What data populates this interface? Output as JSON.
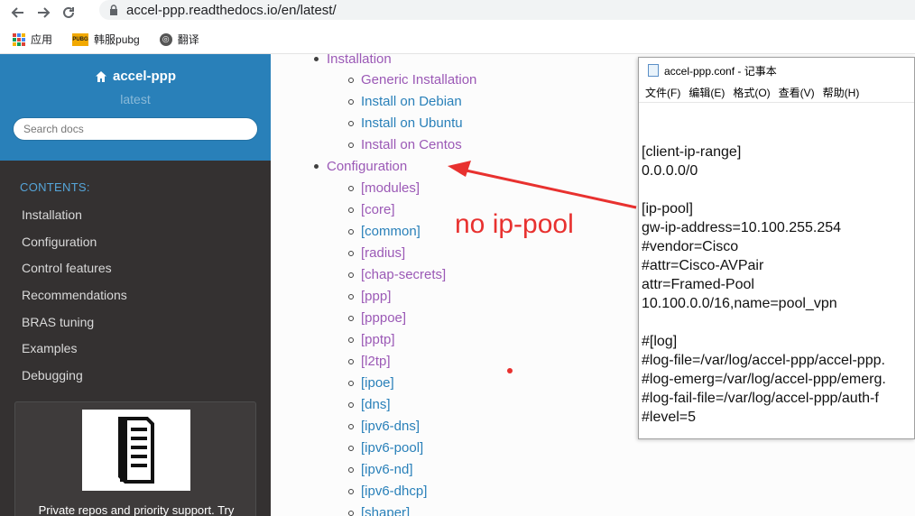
{
  "browser": {
    "url": "accel-ppp.readthedocs.io/en/latest/",
    "bookmarks": [
      "应用",
      "韩服pubg",
      "翻译"
    ],
    "pubg_icon_text": "PUBG"
  },
  "sidebar": {
    "project": "accel-ppp",
    "version": "latest",
    "search_placeholder": "Search docs",
    "caption": "CONTENTS:",
    "items": [
      "Installation",
      "Configuration",
      "Control features",
      "Recommendations",
      "BRAS tuning",
      "Examples",
      "Debugging"
    ],
    "promo_text": "Private repos and priority support. Try"
  },
  "toc": {
    "installation": "Installation",
    "installation_children": [
      "Generic Installation",
      "Install on Debian",
      "Install on Ubuntu",
      "Install on Centos"
    ],
    "configuration": "Configuration",
    "configuration_children": [
      "[modules]",
      "[core]",
      "[common]",
      "[radius]",
      "[chap-secrets]",
      "[ppp]",
      "[pppoe]",
      "[pptp]",
      "[l2tp]",
      "[ipoe]",
      "[dns]",
      "[ipv6-dns]",
      "[ipv6-pool]",
      "[ipv6-nd]",
      "[ipv6-dhcp]",
      "[shaper]"
    ]
  },
  "annotation": "no ip-pool",
  "notepad": {
    "title": "accel-ppp.conf - 记事本",
    "menu": [
      "文件(F)",
      "编辑(E)",
      "格式(O)",
      "查看(V)",
      "帮助(H)"
    ],
    "lines": [
      "[client-ip-range]",
      "0.0.0.0/0",
      "",
      "[ip-pool]",
      "gw-ip-address=10.100.255.254",
      "#vendor=Cisco",
      "#attr=Cisco-AVPair",
      "attr=Framed-Pool",
      "10.100.0.0/16,name=pool_vpn",
      "",
      "#[log]",
      "#log-file=/var/log/accel-ppp/accel-ppp.",
      "#log-emerg=/var/log/accel-ppp/emerg.",
      "#log-fail-file=/var/log/accel-ppp/auth-f",
      "#level=5"
    ]
  },
  "colors": {
    "sidebar_head": "#2980b9",
    "sidebar_bg": "#343131",
    "link": "#2980b9",
    "visited": "#9b59b6",
    "annotation": "#e8312f"
  }
}
